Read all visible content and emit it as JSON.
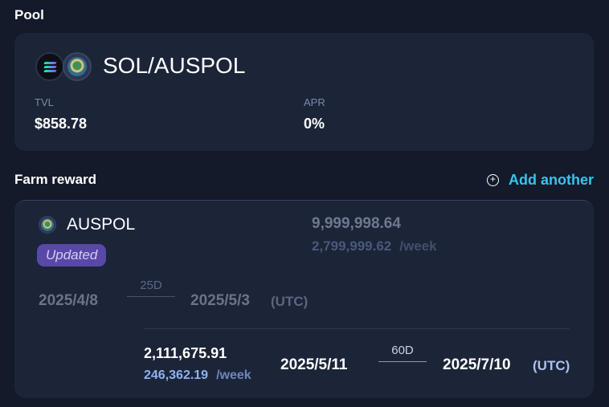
{
  "pool": {
    "section_title": "Pool",
    "pair_name": "SOL/AUSPOL",
    "tvl_label": "TVL",
    "tvl_value": "$858.78",
    "apr_label": "APR",
    "apr_value": "0%"
  },
  "farm": {
    "section_title": "Farm reward",
    "add_another_label": "Add another",
    "add_icon_glyph": "+",
    "reward": {
      "token": "AUSPOL",
      "badge": "Updated",
      "total_amount": "9,999,998.64",
      "weekly_amount": "2,799,999.62",
      "weekly_suffix": "/week",
      "start_date": "2025/4/8",
      "duration": "25D",
      "end_date": "2025/5/3",
      "timezone": "(UTC)"
    },
    "update": {
      "total_amount": "2,111,675.91",
      "weekly_amount": "246,362.19",
      "weekly_suffix": "/week",
      "start_date": "2025/5/11",
      "duration": "60D",
      "end_date": "2025/7/10",
      "timezone": "(UTC)"
    }
  },
  "colors": {
    "background": "#131a2a",
    "card": "#1c2438",
    "accent_link": "#39c4ec",
    "badge": "#5a48a6",
    "weekly_highlight": "#8eb2f2"
  },
  "icons": {
    "sol": "sol-token-icon",
    "auspol": "auspol-token-icon",
    "add": "plus-circle-icon"
  }
}
